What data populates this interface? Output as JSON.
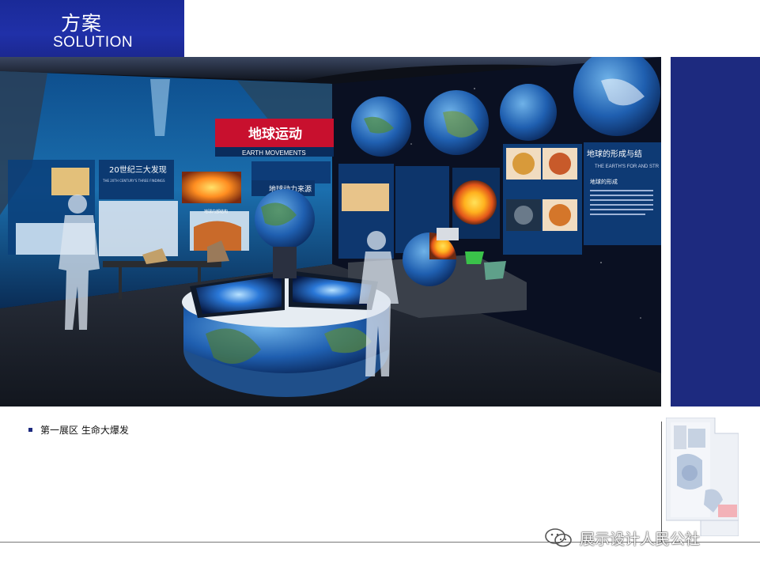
{
  "header": {
    "title_cn": "方案",
    "title_en": "SOLUTION",
    "accent_color": "#1d2a7f"
  },
  "photo": {
    "panel_title_cn": "地球运动",
    "panel_title_en": "EARTH MOVEMENTS",
    "panel_left_1": "20世纪三大发现",
    "panel_left_1_sub": "THE 20TH CENTURY'S THREE FINDINGS",
    "panel_left_2": "地球动力来源",
    "panel_left_label": "地球内部结构",
    "panel_right_title": "地球的形成与结",
    "panel_right_sub": "THE EARTH'S FOR AND STR",
    "panel_right_heading": "地球的形成"
  },
  "caption": {
    "text": "第一展区 生命大爆发"
  },
  "watermark": {
    "text": "展示设计人民公社",
    "icon": "wechat-icon"
  }
}
